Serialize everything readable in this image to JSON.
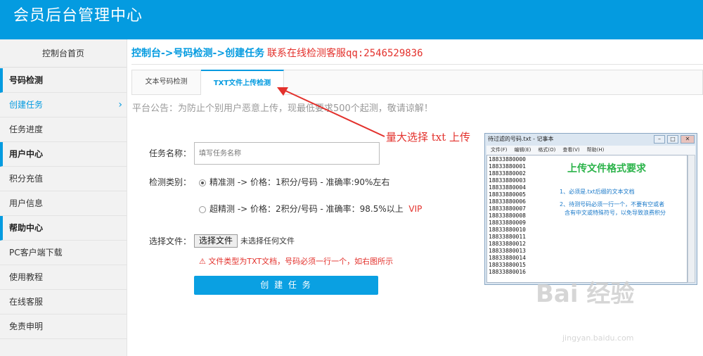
{
  "header": {
    "title": "会员后台管理中心"
  },
  "sidebar": {
    "home": "控制台首页",
    "items": [
      {
        "label": "号码检测",
        "kind": "section"
      },
      {
        "label": "创建任务",
        "kind": "active"
      },
      {
        "label": "任务进度",
        "kind": "item"
      },
      {
        "label": "用户中心",
        "kind": "section"
      },
      {
        "label": "积分充值",
        "kind": "item"
      },
      {
        "label": "用户信息",
        "kind": "item"
      },
      {
        "label": "帮助中心",
        "kind": "section"
      },
      {
        "label": "PC客户端下载",
        "kind": "item"
      },
      {
        "label": "使用教程",
        "kind": "item"
      },
      {
        "label": "在线客服",
        "kind": "item"
      },
      {
        "label": "免责申明",
        "kind": "item"
      }
    ],
    "active_chevron": "›"
  },
  "breadcrumb": {
    "path": "控制台->号码检测->创建任务",
    "note": "联系在线检测客服qq:2546529836"
  },
  "tabs": [
    {
      "label": "文本号码检测",
      "active": false
    },
    {
      "label": "TXT文件上传检测",
      "active": true
    }
  ],
  "notice": "平台公告：为防止个别用户恶意上传，现最低要求500个起测，敬请谅解！",
  "form": {
    "task_name_label": "任务名称：",
    "task_name_placeholder": "填写任务名称",
    "category_label": "检测类别：",
    "options": [
      {
        "text": "精准测 -> 价格：1积分/号码 - 准确率:90%左右",
        "selected": true,
        "badge": ""
      },
      {
        "text": "超精测 -> 价格：2积分/号码 - 准确率：98.5%以上",
        "selected": false,
        "badge": "VIP"
      }
    ],
    "file_label": "选择文件：",
    "file_button": "选择文件",
    "file_status": "未选择任何文件",
    "warning": "⚠ 文件类型为TXT文档，号码必须一行一个，如右图所示",
    "submit": "创 建 任 务"
  },
  "annotation": "量大选择 txt 上传",
  "notepad": {
    "title": "待过滤的号码.txt - 记事本",
    "menu": [
      "文件(F)",
      "编辑(E)",
      "格式(O)",
      "查看(V)",
      "帮助(H)"
    ],
    "numbers": [
      "18833880000",
      "18833880001",
      "18833880002",
      "18833880003",
      "18833880004",
      "18833880005",
      "18833880006",
      "18833880007",
      "18833880008",
      "18833880009",
      "18833880010",
      "18833880011",
      "18833880012",
      "18833880013",
      "18833880014",
      "18833880015",
      "18833880016"
    ],
    "heading": "上传文件格式要求",
    "tips": [
      "1、必须是.txt后缀的文本文档",
      "2、待测号码必须一行一个，不要有空或者",
      "含有中文或特殊符号，以免导致浪费积分"
    ]
  },
  "watermark": {
    "logo": "Bai  经验",
    "url": "jingyan.baidu.com"
  },
  "colors": {
    "accent": "#049be0",
    "danger": "#e3312c",
    "tip_heading": "#2bb34a"
  }
}
